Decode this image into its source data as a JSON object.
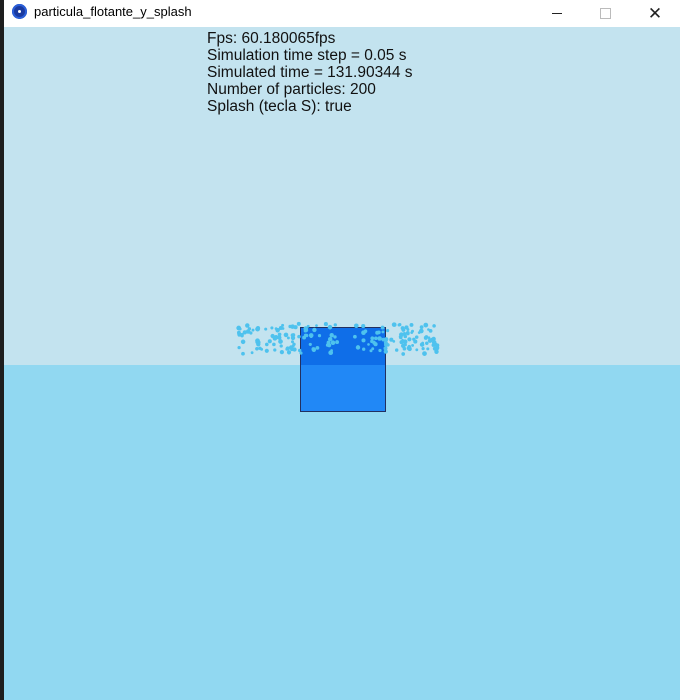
{
  "window": {
    "title": "particula_flotante_y_splash",
    "minimize_symbol": "—",
    "close_symbol": "✕"
  },
  "hud": {
    "fps": "Fps: 60.180065fps",
    "time_step": "Simulation time step = 0.05 s",
    "simulated_time": "Simulated time = 131.90344 s",
    "particles": "Number of particles: 200",
    "splash": "Splash (tecla S): true"
  },
  "colors": {
    "sky": "#c3e3ef",
    "water": "#91d8f1",
    "box_above_water": "#0f6ee8",
    "box_below_water": "#2188f6",
    "particle": "#4ec2ee"
  },
  "icons": {
    "app": "app-icon",
    "minimize": "minimize-icon",
    "maximize": "maximize-icon",
    "close": "close-icon"
  }
}
